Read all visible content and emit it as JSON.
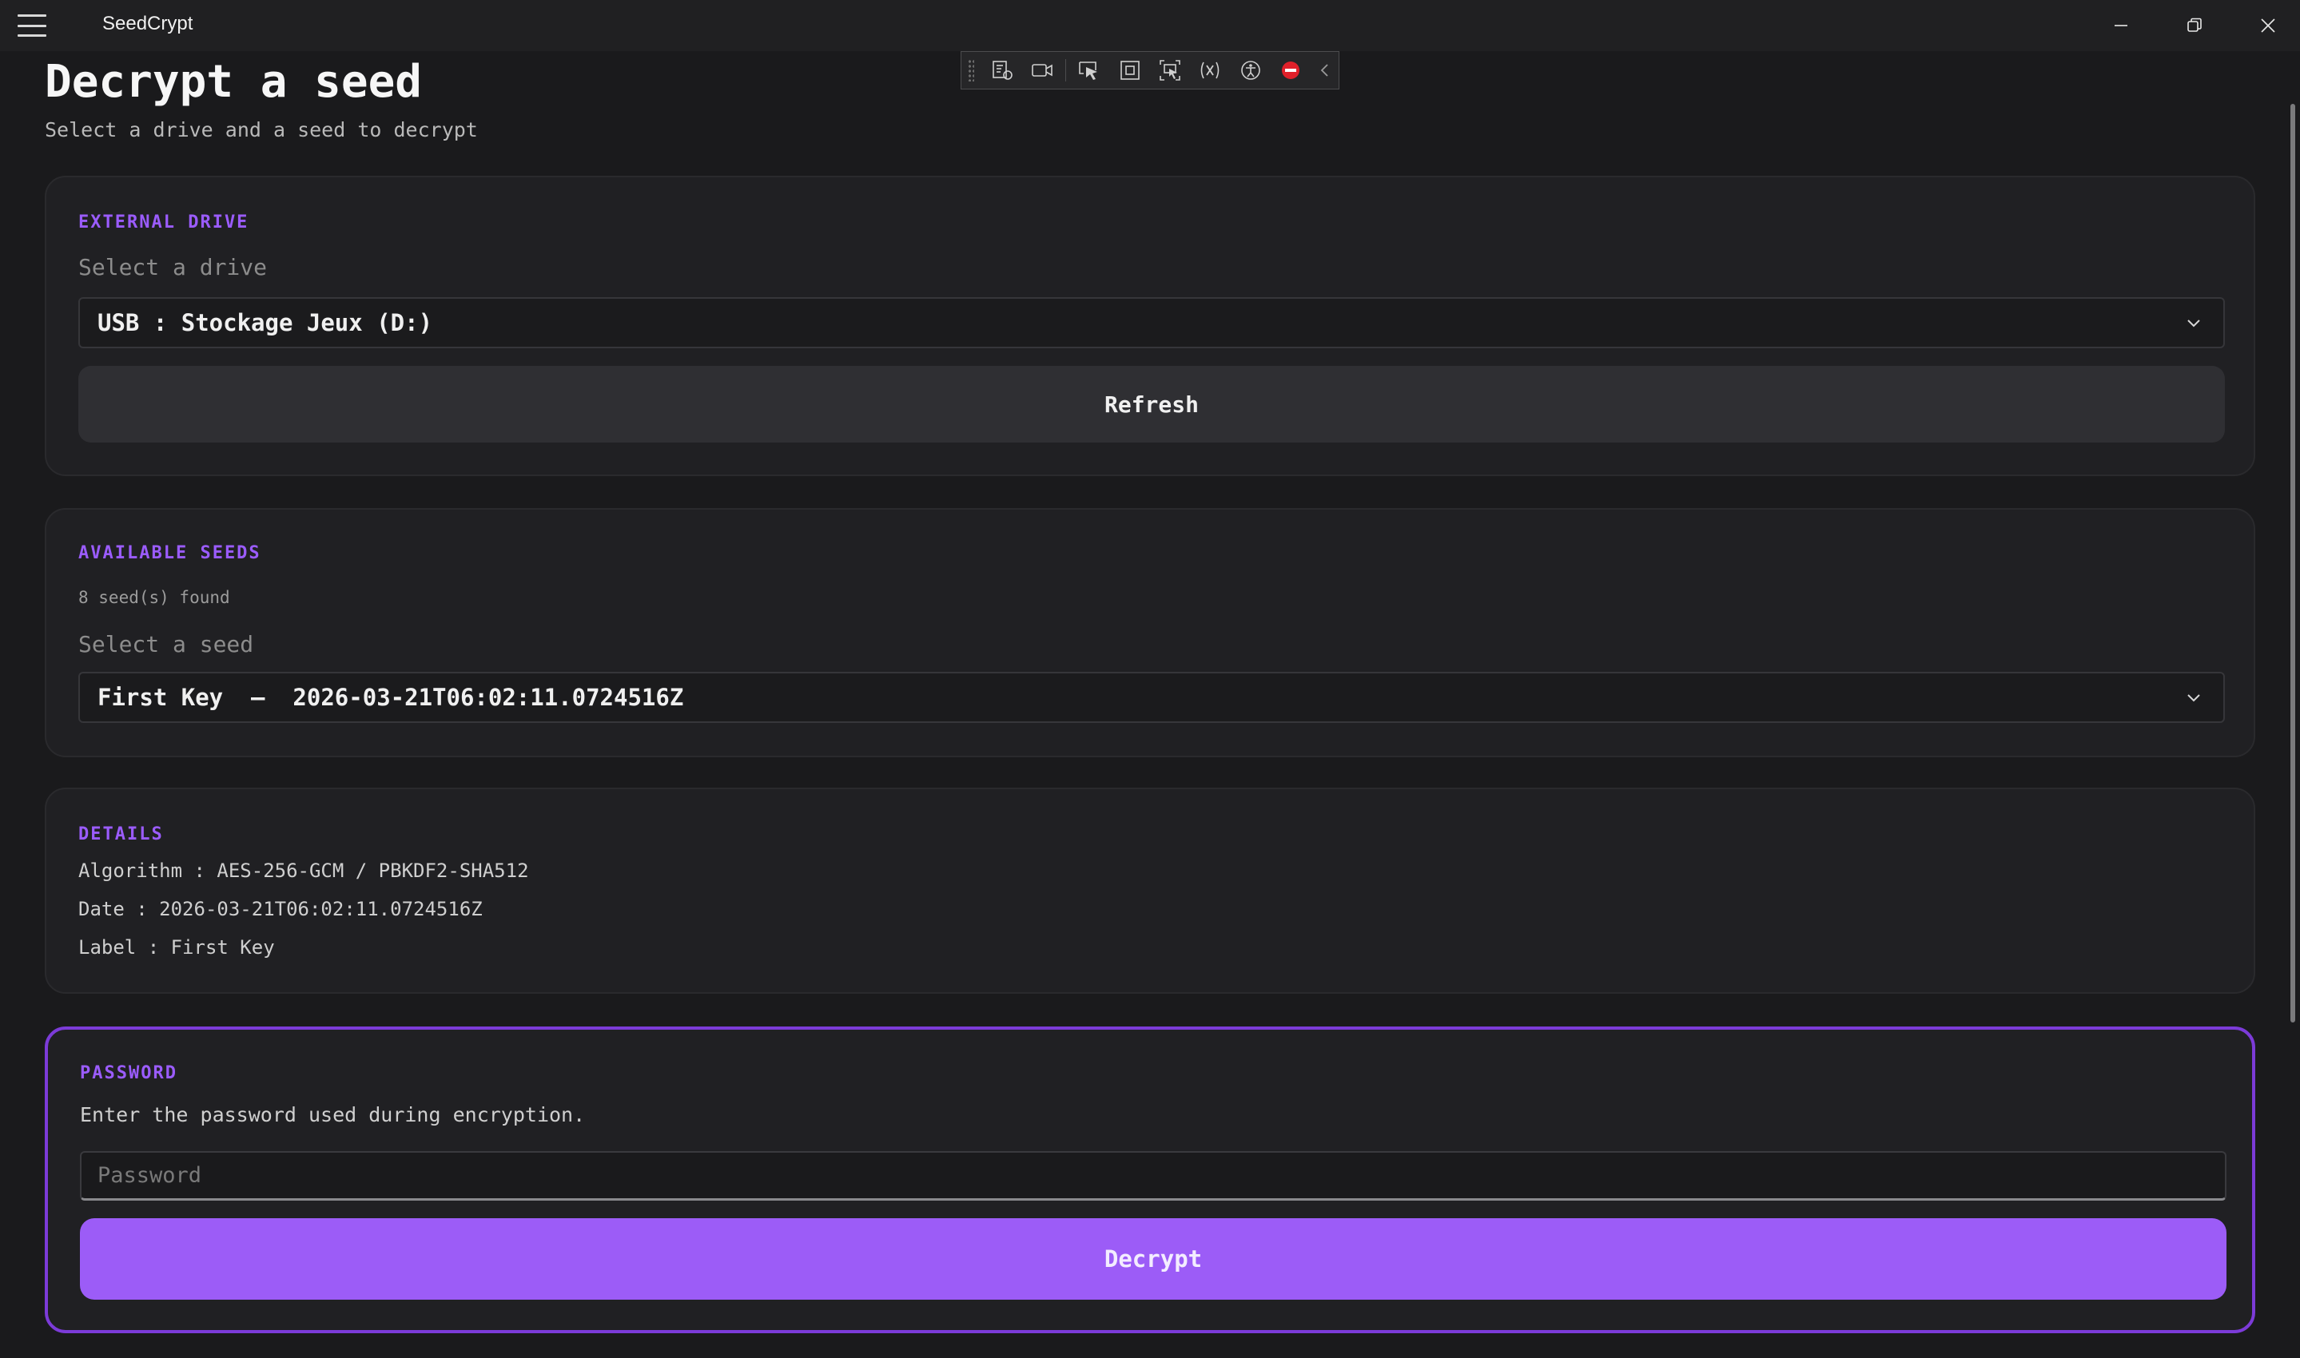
{
  "window": {
    "title": "SeedCrypt",
    "controls": [
      "minimize",
      "restore",
      "close"
    ]
  },
  "debug_toolbar": {
    "icons": [
      "live-visual-tree-icon",
      "record-icon",
      "select-element-icon",
      "display-layout-adorners-icon",
      "track-focus-icon",
      "hot-reload-icon",
      "accessibility-icon",
      "stop-icon",
      "collapse-icon"
    ]
  },
  "header": {
    "title": "Decrypt a seed",
    "subtitle": "Select a drive and a seed to decrypt"
  },
  "external_drive": {
    "section_label": "EXTERNAL DRIVE",
    "field_label": "Select a drive",
    "selected": "USB : Stockage Jeux (D:)",
    "refresh_label": "Refresh"
  },
  "available_seeds": {
    "section_label": "AVAILABLE SEEDS",
    "count_text": "8 seed(s) found",
    "field_label": "Select a seed",
    "selected": "First Key  —  2026-03-21T06:02:11.0724516Z"
  },
  "details": {
    "section_label": "DETAILS",
    "algorithm": "Algorithm : AES-256-GCM / PBKDF2-SHA512",
    "date": "Date : 2026-03-21T06:02:11.0724516Z",
    "label": "Label : First Key"
  },
  "password": {
    "section_label": "PASSWORD",
    "hint": "Enter the password used during encryption.",
    "placeholder": "Password",
    "value": "",
    "decrypt_label": "Decrypt"
  },
  "colors": {
    "accent": "#9b5cff",
    "button_primary": "#9c5cf7",
    "background": "#1a1a1c",
    "card": "#202023"
  }
}
